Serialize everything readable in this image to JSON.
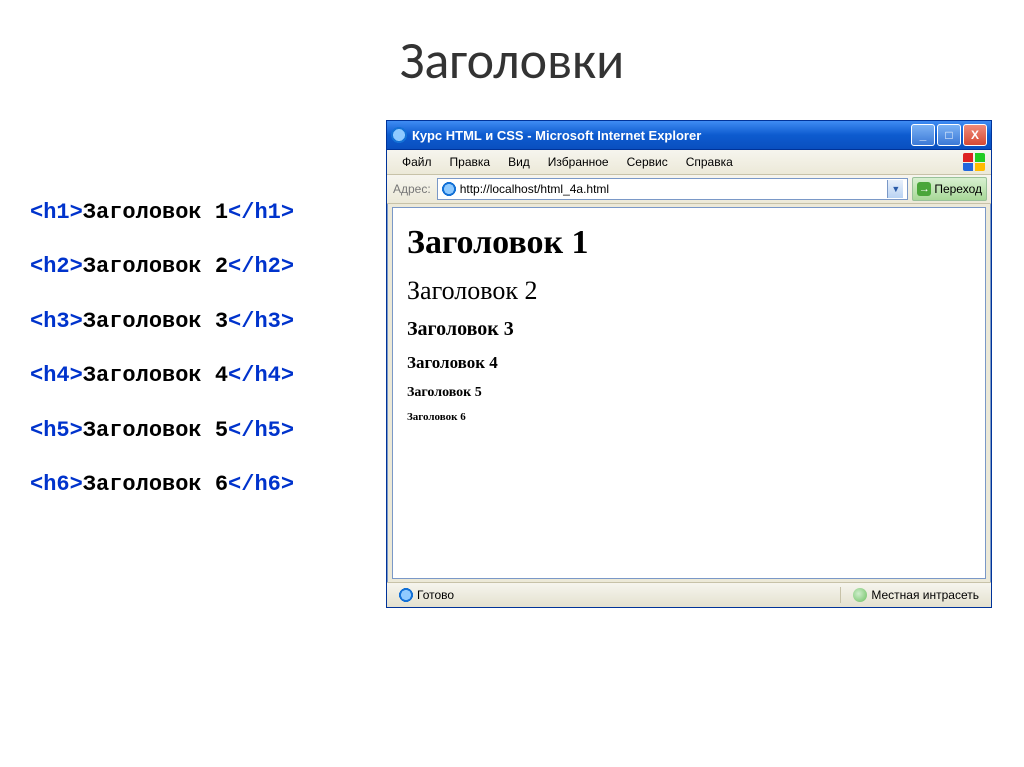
{
  "slide": {
    "title": "Заголовки"
  },
  "code": {
    "lines": [
      {
        "open": "<h1>",
        "text": "Заголовок 1",
        "close": "</h1>"
      },
      {
        "open": "<h2>",
        "text": "Заголовок 2",
        "close": "</h2>"
      },
      {
        "open": "<h3>",
        "text": "Заголовок 3",
        "close": "</h3>"
      },
      {
        "open": "<h4>",
        "text": "Заголовок 4",
        "close": "</h4>"
      },
      {
        "open": "<h5>",
        "text": "Заголовок 5",
        "close": "</h5>"
      },
      {
        "open": "<h6>",
        "text": "Заголовок 6",
        "close": "</h6>"
      }
    ]
  },
  "browser": {
    "title": "Курс HTML и CSS - Microsoft Internet Explorer",
    "menu": {
      "file": "Файл",
      "edit": "Правка",
      "view": "Вид",
      "favorites": "Избранное",
      "tools": "Сервис",
      "help": "Справка"
    },
    "address_label": "Адрес:",
    "url": "http://localhost/html_4a.html",
    "go_label": "Переход",
    "headings": {
      "h1": "Заголовок 1",
      "h2": "Заголовок 2",
      "h3": "Заголовок 3",
      "h4": "Заголовок 4",
      "h5": "Заголовок 5",
      "h6": "Заголовок 6"
    },
    "status": {
      "ready": "Готово",
      "zone": "Местная интрасеть"
    },
    "win_buttons": {
      "min": "_",
      "max": "□",
      "close": "X"
    }
  }
}
